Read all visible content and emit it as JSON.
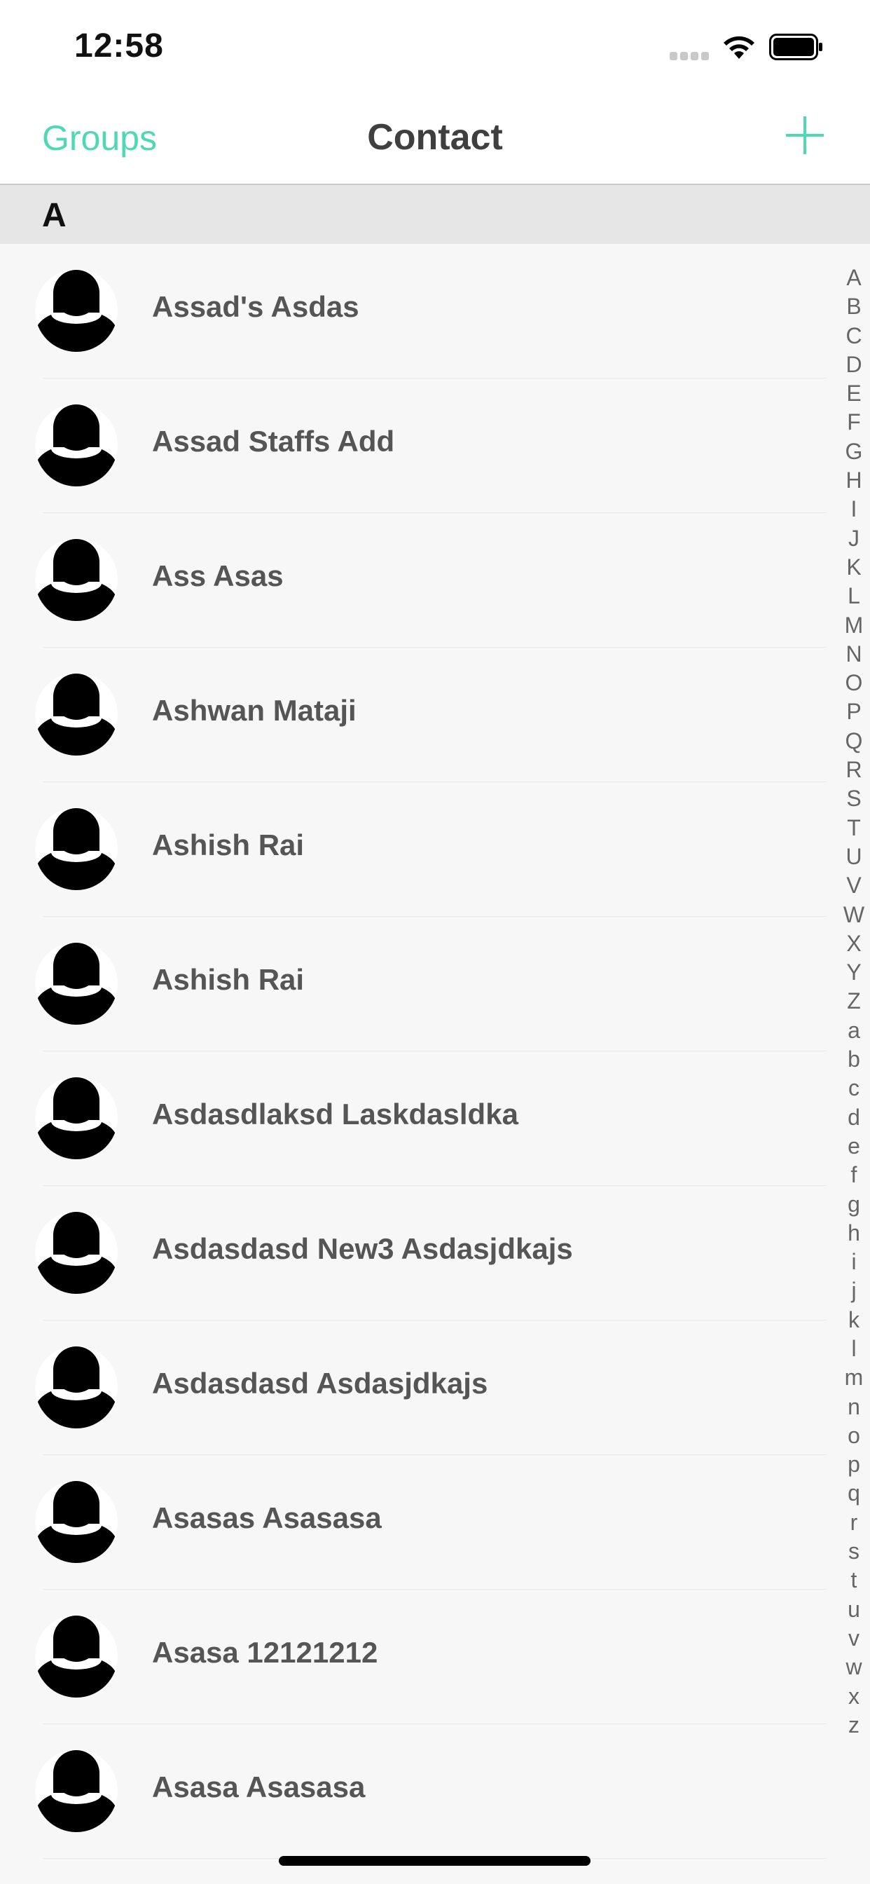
{
  "status_bar": {
    "time": "12:58"
  },
  "nav": {
    "left_button": "Groups",
    "title": "Contact",
    "add_icon": "plus-icon"
  },
  "colors": {
    "accent": "#4fd8b4",
    "section_bg": "#e6e6e6",
    "list_bg": "#f7f7f7",
    "name_text": "#555555"
  },
  "section": {
    "letter": "A"
  },
  "contacts": [
    {
      "name": "Assad's Asdas"
    },
    {
      "name": "Assad Staffs Add"
    },
    {
      "name": "Ass Asas"
    },
    {
      "name": "Ashwan Mataji"
    },
    {
      "name": "Ashish Rai"
    },
    {
      "name": "Ashish Rai"
    },
    {
      "name": "Asdasdlaksd Laskdasldka"
    },
    {
      "name": "Asdasdasd New3 Asdasjdkajs"
    },
    {
      "name": "Asdasdasd Asdasjdkajs"
    },
    {
      "name": "Asasas Asasasa"
    },
    {
      "name": "Asasa 12121212"
    },
    {
      "name": "Asasa Asasasa"
    }
  ],
  "index": [
    "A",
    "B",
    "C",
    "D",
    "E",
    "F",
    "G",
    "H",
    "I",
    "J",
    "K",
    "L",
    "M",
    "N",
    "O",
    "P",
    "Q",
    "R",
    "S",
    "T",
    "U",
    "V",
    "W",
    "X",
    "Y",
    "Z",
    "a",
    "b",
    "c",
    "d",
    "e",
    "f",
    "g",
    "h",
    "i",
    "j",
    "k",
    "l",
    "m",
    "n",
    "o",
    "p",
    "q",
    "r",
    "s",
    "t",
    "u",
    "v",
    "w",
    "x",
    "z"
  ]
}
